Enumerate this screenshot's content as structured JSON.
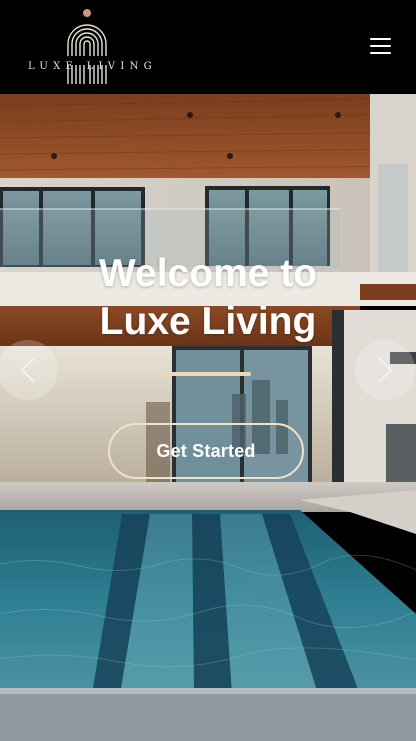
{
  "header": {
    "logo_text": "LUXE LIVING",
    "menu_icon": "hamburger-menu-icon"
  },
  "hero": {
    "title_line1": "Welcome to",
    "title_line2": "Luxe Living",
    "cta_label": "Get Started",
    "prev_icon": "chevron-left-icon",
    "next_icon": "chevron-right-icon"
  },
  "colors": {
    "header_bg": "#000000",
    "accent_gold": "#efd8b5",
    "text_white": "#ffffff"
  }
}
